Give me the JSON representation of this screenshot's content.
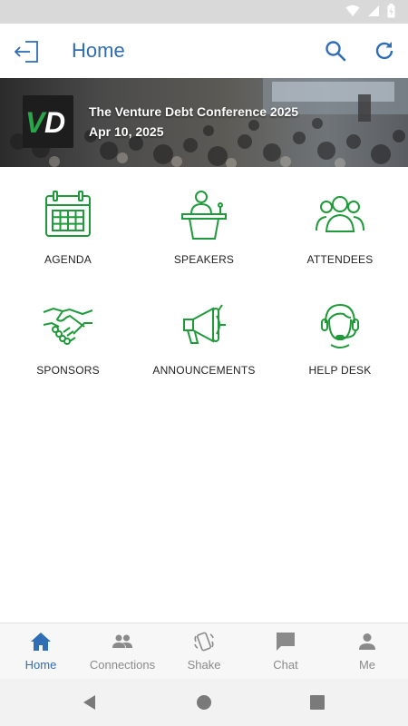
{
  "app_bar": {
    "title": "Home"
  },
  "banner": {
    "event_title": "The Venture Debt Conference 2025",
    "event_date": "Apr 10, 2025",
    "logo_text": "VD"
  },
  "tiles": [
    {
      "label": "AGENDA",
      "icon": "calendar-icon"
    },
    {
      "label": "SPEAKERS",
      "icon": "podium-icon"
    },
    {
      "label": "ATTENDEES",
      "icon": "people-icon"
    },
    {
      "label": "SPONSORS",
      "icon": "handshake-icon"
    },
    {
      "label": "ANNOUNCEMENTS",
      "icon": "megaphone-icon"
    },
    {
      "label": "HELP DESK",
      "icon": "headset-icon"
    }
  ],
  "bottom_nav": [
    {
      "label": "Home",
      "icon": "home-icon",
      "active": true
    },
    {
      "label": "Connections",
      "icon": "people-icon",
      "active": false
    },
    {
      "label": "Shake",
      "icon": "shake-icon",
      "active": false
    },
    {
      "label": "Chat",
      "icon": "chat-icon",
      "active": false
    },
    {
      "label": "Me",
      "icon": "person-icon",
      "active": false
    }
  ],
  "colors": {
    "accent": "#2f6db5",
    "icon_green": "#1f9a3a",
    "nav_inactive": "#8a8a8a"
  }
}
